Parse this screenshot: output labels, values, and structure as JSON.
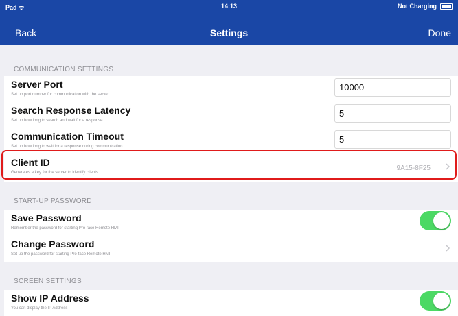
{
  "status": {
    "left": "Pad ᯤ",
    "time": "14:13",
    "charge": "Not Charging"
  },
  "nav": {
    "back": "Back",
    "title": "Settings",
    "done": "Done"
  },
  "sections": {
    "communication": {
      "header": "COMMUNICATION SETTINGS",
      "server_port": {
        "title": "Server Port",
        "desc": "Set up port number for communication with the server",
        "value": "10000"
      },
      "latency": {
        "title": "Search Response Latency",
        "desc": "Set up how long to search and wait for a response",
        "value": "5"
      },
      "timeout": {
        "title": "Communication Timeout",
        "desc": "Set up how long to wait for a response during communication",
        "value": "5"
      },
      "client_id": {
        "title": "Client ID",
        "desc": "Generates a key for the server to identify clients",
        "value": "9A15-8F25"
      }
    },
    "startup": {
      "header": "START-UP PASSWORD",
      "save_password": {
        "title": "Save Password",
        "desc": "Remember the password for starting Pro-face Remote HMI",
        "toggle": "on"
      },
      "change_password": {
        "title": "Change Password",
        "desc": "Set up the password for starting Pro-face Remote HMI"
      }
    },
    "screen": {
      "header": "SCREEN SETTINGS",
      "show_ip": {
        "title": "Show IP Address",
        "desc": "You can display the IP Address",
        "toggle": "on"
      }
    }
  },
  "colors": {
    "nav_bg": "#1a47a6",
    "toggle_on": "#4cd964",
    "highlight": "#e01b1b"
  }
}
